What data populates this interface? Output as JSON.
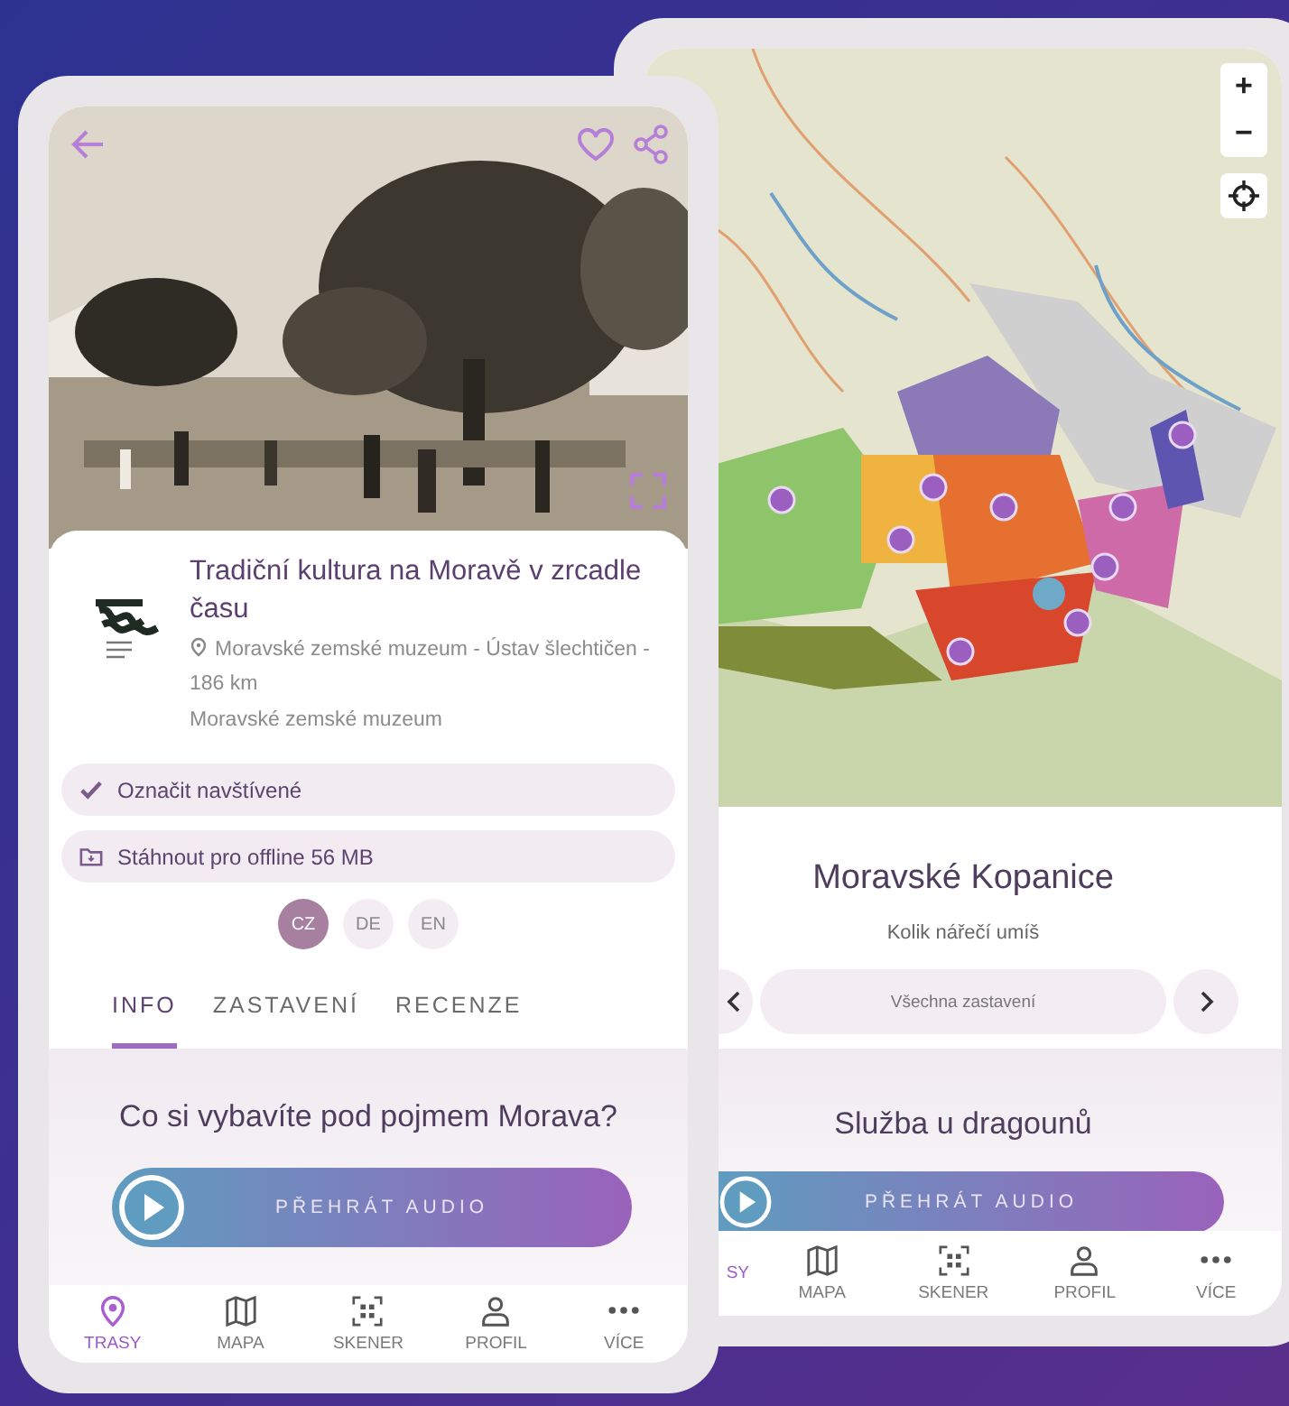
{
  "front_screen": {
    "tour": {
      "title": "Tradiční kultura na Moravě v zrcadle času",
      "location": "Moravské zemské muzeum - Ústav šlechtičen - 186 km",
      "organizer": "Moravské zemské muzeum"
    },
    "actions": [
      {
        "label": "Označit navštívené",
        "kind": "visited"
      },
      {
        "label": "Stáhnout pro offline 56 MB",
        "kind": "download"
      }
    ],
    "languages": [
      {
        "label": "CZ",
        "selected": true
      },
      {
        "label": "DE",
        "selected": false
      },
      {
        "label": "EN",
        "selected": false
      }
    ],
    "tabs": [
      {
        "label": "INFO",
        "selected": true
      },
      {
        "label": "ZASTAVENÍ",
        "selected": false
      },
      {
        "label": "RECENZE",
        "selected": false
      }
    ],
    "stop": {
      "title": "Co si vybavíte pod pojmem Morava?",
      "audio_button": "PŘEHRÁT AUDIO"
    },
    "nav": [
      {
        "label": "TRASY",
        "kind": "routes",
        "selected": true
      },
      {
        "label": "MAPA",
        "kind": "map",
        "selected": false
      },
      {
        "label": "SKENER",
        "kind": "scanner",
        "selected": false
      },
      {
        "label": "PROFIL",
        "kind": "profile",
        "selected": false
      },
      {
        "label": "VÍCE",
        "kind": "more",
        "selected": false
      }
    ]
  },
  "back_screen": {
    "map": {
      "kind": "picture",
      "zoom_in": "+",
      "zoom_out": "−"
    },
    "route": {
      "title": "Moravské Kopanice",
      "subtitle": "Kolik nářečí umíš"
    },
    "stop_selector": "Všechna zastavení",
    "stop": {
      "title": "Služba u dragounů",
      "audio_button": "PŘEHRÁT AUDIO"
    },
    "nav": [
      {
        "label": "SY",
        "kind": "cut",
        "selected": true
      },
      {
        "label": "MAPA",
        "kind": "map",
        "selected": false
      },
      {
        "label": "SKENER",
        "kind": "scanner",
        "selected": false
      },
      {
        "label": "PROFIL",
        "kind": "profile",
        "selected": false
      },
      {
        "label": "VÍCE",
        "kind": "more",
        "selected": false
      }
    ]
  }
}
